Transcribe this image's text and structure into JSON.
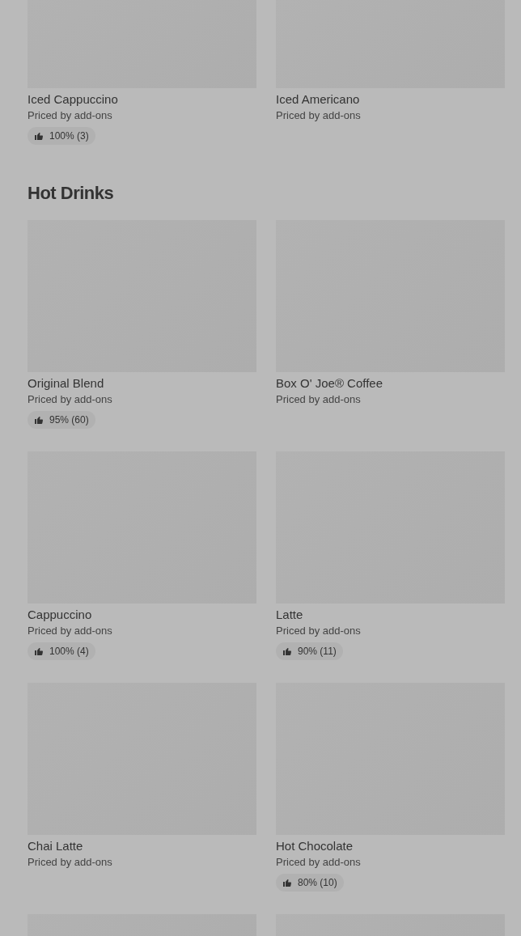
{
  "sections": [
    {
      "items": [
        {
          "name": "Iced Cappuccino",
          "subtitle": "Priced by add-ons",
          "rating": "100% (3)"
        },
        {
          "name": "Iced Americano",
          "subtitle": "Priced by add-ons"
        }
      ]
    },
    {
      "title": "Hot Drinks",
      "items": [
        {
          "name": "Original Blend",
          "subtitle": "Priced by add-ons",
          "rating": "95% (60)"
        },
        {
          "name": "Box O' Joe® Coffee",
          "subtitle": "Priced by add-ons"
        },
        {
          "name": "Cappuccino",
          "subtitle": "Priced by add-ons",
          "rating": "100% (4)"
        },
        {
          "name": "Latte",
          "subtitle": "Priced by add-ons",
          "rating": "90% (11)"
        },
        {
          "name": "Chai Latte",
          "subtitle": "Priced by add-ons"
        },
        {
          "name": "Hot Chocolate",
          "subtitle": "Priced by add-ons",
          "rating": "80% (10)"
        },
        {
          "kind": "cut_off"
        },
        {
          "kind": "cut_off"
        }
      ]
    }
  ]
}
